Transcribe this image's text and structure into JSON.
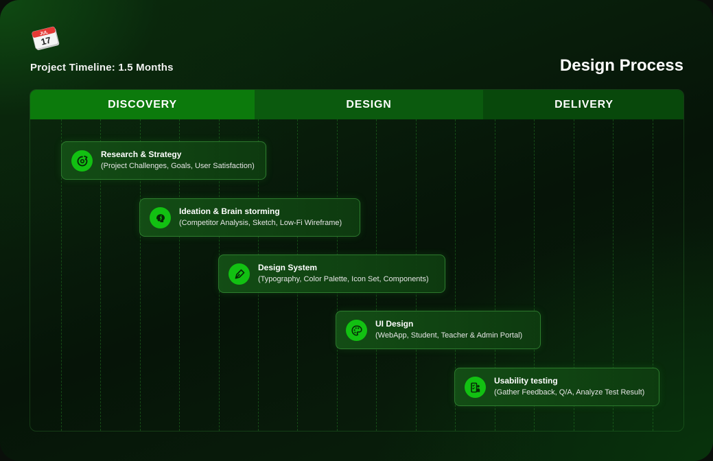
{
  "header": {
    "calendar_icon_month": "JUL",
    "calendar_icon_day": "17",
    "timeline_label": "Project Timeline: 1.5 Months",
    "title": "Design Process"
  },
  "phases": [
    {
      "label": "DISCOVERY"
    },
    {
      "label": "DESIGN"
    },
    {
      "label": "DELIVERY"
    }
  ],
  "tasks": [
    {
      "title": "Research & Strategy",
      "subtitle": "(Project Challenges, Goals, User Satisfaction)",
      "icon": "research-refresh-icon"
    },
    {
      "title": "Ideation & Brain storming",
      "subtitle": "(Competitor Analysis, Sketch, Low-Fi Wireframe)",
      "icon": "brain-icon"
    },
    {
      "title": "Design System",
      "subtitle": "(Typography, Color Palette, Icon Set, Components)",
      "icon": "pen-nib-icon"
    },
    {
      "title": "UI Design",
      "subtitle": "(WebApp, Student, Teacher & Admin Portal)",
      "icon": "palette-icon"
    },
    {
      "title": "Usability testing",
      "subtitle": "(Gather Feedback, Q/A, Analyze Test Result)",
      "icon": "usability-test-icon"
    }
  ],
  "colors": {
    "accent": "#12c012",
    "phase_discovery": "#0c7a0c",
    "phase_design": "#0b5a0e",
    "phase_delivery": "#08480b"
  }
}
